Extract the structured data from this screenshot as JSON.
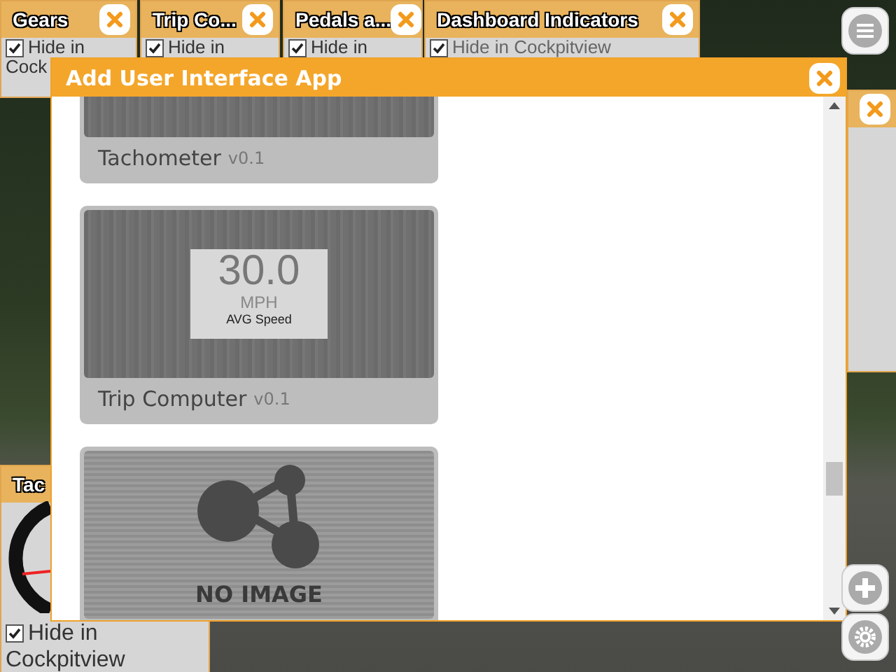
{
  "top_widgets": [
    {
      "title": "Gears",
      "hide_lines": [
        "Hide in",
        "Cock"
      ],
      "checked": true
    },
    {
      "title": "Trip Co...",
      "hide_lines": [
        "Hide in"
      ],
      "checked": true
    },
    {
      "title": "Pedals a...",
      "hide_lines": [
        "Hide in"
      ],
      "checked": true
    },
    {
      "title": "Dashboard Indicators",
      "hide_lines": [
        "Hide in Cockpitview"
      ],
      "checked": true
    }
  ],
  "bottom_widget": {
    "title": "Tac",
    "hide_lines": [
      "Hide in",
      "Cockpitview"
    ],
    "checked": true
  },
  "dialog": {
    "title": "Add User Interface App",
    "apps": [
      {
        "kind": "texture",
        "name": "Tachometer",
        "version": "v0.1"
      },
      {
        "kind": "speed",
        "name": "Trip Computer",
        "version": "v0.1",
        "speed": {
          "value": "30.0",
          "unit": "MPH",
          "caption": "AVG Speed"
        }
      },
      {
        "kind": "no_image",
        "no_image_text": "NO IMAGE"
      }
    ]
  }
}
